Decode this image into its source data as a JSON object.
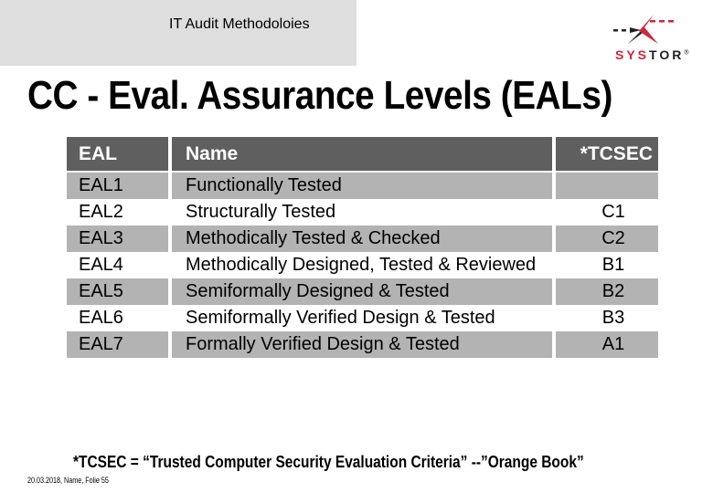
{
  "header": {
    "title": "IT Audit Methodoloies",
    "logo": {
      "brand_red": "SYS",
      "brand_dark": "TOR",
      "registered": "®",
      "icon": "systor-logo-icon"
    }
  },
  "slide_title": "CC - Eval. Assurance Levels (EALs)",
  "table": {
    "headers": [
      "EAL",
      "Name",
      "*TCSEC"
    ],
    "rows": [
      {
        "eal": "EAL1",
        "name": "Functionally Tested",
        "tcsec": ""
      },
      {
        "eal": "EAL2",
        "name": "Structurally Tested",
        "tcsec": "C1"
      },
      {
        "eal": "EAL3",
        "name": "Methodically Tested & Checked",
        "tcsec": "C2"
      },
      {
        "eal": "EAL4",
        "name": "Methodically Designed, Tested & Reviewed",
        "tcsec": "B1"
      },
      {
        "eal": "EAL5",
        "name": "Semiformally Designed & Tested",
        "tcsec": "B2"
      },
      {
        "eal": "EAL6",
        "name": "Semiformally Verified Design & Tested",
        "tcsec": "B3"
      },
      {
        "eal": "EAL7",
        "name": "Formally Verified Design & Tested",
        "tcsec": "A1"
      }
    ]
  },
  "footnote": "*TCSEC = “Trusted Computer Security Evaluation Criteria” --”Orange Book”",
  "footer": "20.03.2018, Name, Folie 55",
  "colors": {
    "header_bg": "#5f5f5f",
    "shade_bg": "#b3b3b3",
    "brand_red": "#d0263a",
    "band_bg": "#dedede"
  }
}
